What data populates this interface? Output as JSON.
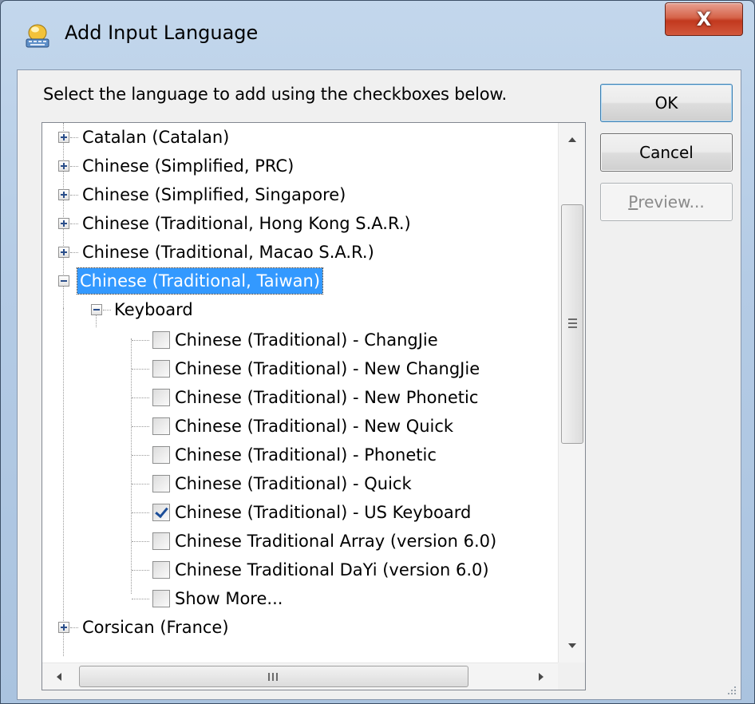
{
  "window": {
    "title": "Add Input Language",
    "close_label": "X"
  },
  "dialog": {
    "instruction": "Select the language to add using the checkboxes below.",
    "ok_label": "OK",
    "cancel_label": "Cancel",
    "preview_label_prefix": "P",
    "preview_label_rest": "review..."
  },
  "tree": {
    "languages_before": [
      "Catalan (Catalan)",
      "Chinese (Simplified, PRC)",
      "Chinese (Simplified, Singapore)",
      "Chinese (Traditional, Hong Kong S.A.R.)",
      "Chinese (Traditional, Macao S.A.R.)"
    ],
    "selected_language": "Chinese (Traditional, Taiwan)",
    "group_label": "Keyboard",
    "keyboards": [
      {
        "label": "Chinese (Traditional) - ChangJie",
        "checked": false
      },
      {
        "label": "Chinese (Traditional) - New ChangJie",
        "checked": false
      },
      {
        "label": "Chinese (Traditional) - New Phonetic",
        "checked": false
      },
      {
        "label": "Chinese (Traditional) - New Quick",
        "checked": false
      },
      {
        "label": "Chinese (Traditional) - Phonetic",
        "checked": false
      },
      {
        "label": "Chinese (Traditional) - Quick",
        "checked": false
      },
      {
        "label": "Chinese (Traditional) - US Keyboard",
        "checked": true
      },
      {
        "label": "Chinese Traditional Array (version 6.0)",
        "checked": false
      },
      {
        "label": "Chinese Traditional DaYi (version 6.0)",
        "checked": false
      },
      {
        "label": "Show More...",
        "checked": false
      }
    ],
    "language_after": "Corsican (France)"
  },
  "scrollbars": {
    "h_thumb_grip": "III"
  }
}
